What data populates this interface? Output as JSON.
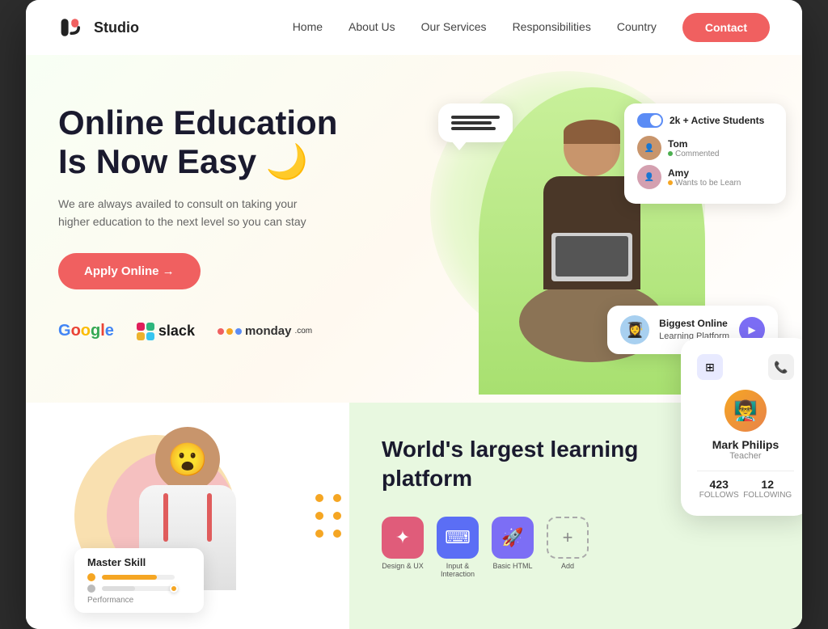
{
  "brand": {
    "name": "Studio",
    "logo_symbol": "ᴘᴊ"
  },
  "nav": {
    "links": [
      "Home",
      "About Us",
      "Our Services",
      "Responsibilities",
      "Country"
    ],
    "contact_label": "Contact"
  },
  "hero": {
    "title_line1": "Online Education",
    "title_line2": "Is Now Easy",
    "title_emoji": "🌙",
    "subtitle": "We are  always availed to consult on taking your higher education to the next level so you can stay",
    "apply_btn": "Apply Online →",
    "partners": [
      "Google",
      "slack",
      "monday.com"
    ]
  },
  "active_students_card": {
    "title": "2k + Active Students",
    "student1_name": "Tom",
    "student1_status": "Commented",
    "student2_name": "Amy",
    "student2_status": "Wants to be Learn"
  },
  "learning_platform_card": {
    "title": "Biggest Online",
    "subtitle": "Learning Platform"
  },
  "bottom": {
    "world_title_line1": "World's largest learning",
    "world_title_line2": "platform",
    "skill_title": "Master Skill",
    "skill_label": "Performance",
    "icons": [
      {
        "label": "Design & UX",
        "color": "#e05c7a",
        "symbol": "✦"
      },
      {
        "label": "Input & Interaction",
        "color": "#5b6ef5",
        "symbol": "◧"
      },
      {
        "label": "Basic HTML",
        "color": "#7c6ef5",
        "symbol": "🚀"
      },
      {
        "label": "Add",
        "color": "transparent",
        "symbol": "+"
      }
    ]
  },
  "profile_card": {
    "name": "Mark Philips",
    "role": "Teacher",
    "follows_label": "FOLLOWS",
    "follows_val": "423",
    "following_label": "FOLLOWING",
    "following_val": "12"
  }
}
